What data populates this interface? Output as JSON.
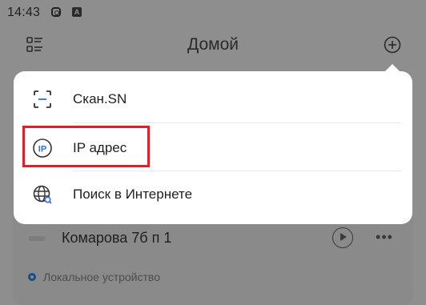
{
  "status_bar": {
    "time": "14:43",
    "icons": [
      "instagram-icon",
      "app-a-icon"
    ],
    "app_a_letter": "A"
  },
  "header": {
    "title": "Домой",
    "left_icon": "list-icon",
    "right_icon": "add-circle-icon"
  },
  "popup_menu": {
    "items": [
      {
        "label": "Скан.SN",
        "icon": "scan-icon"
      },
      {
        "label": "IP адрес",
        "icon": "ip-icon",
        "icon_text": "IP"
      },
      {
        "label": "Поиск в Интернете",
        "icon": "globe-search-icon"
      }
    ]
  },
  "device": {
    "name": "Комарова 7б п 1",
    "status": "Локальное устройство",
    "more_label": "•••"
  },
  "colors": {
    "overlay": "#8e8e8e",
    "popup_background": "#ffffff",
    "highlight": "#e51d2a",
    "ip_icon": "#2f6fd6",
    "status_dot": "#1a4e86"
  }
}
